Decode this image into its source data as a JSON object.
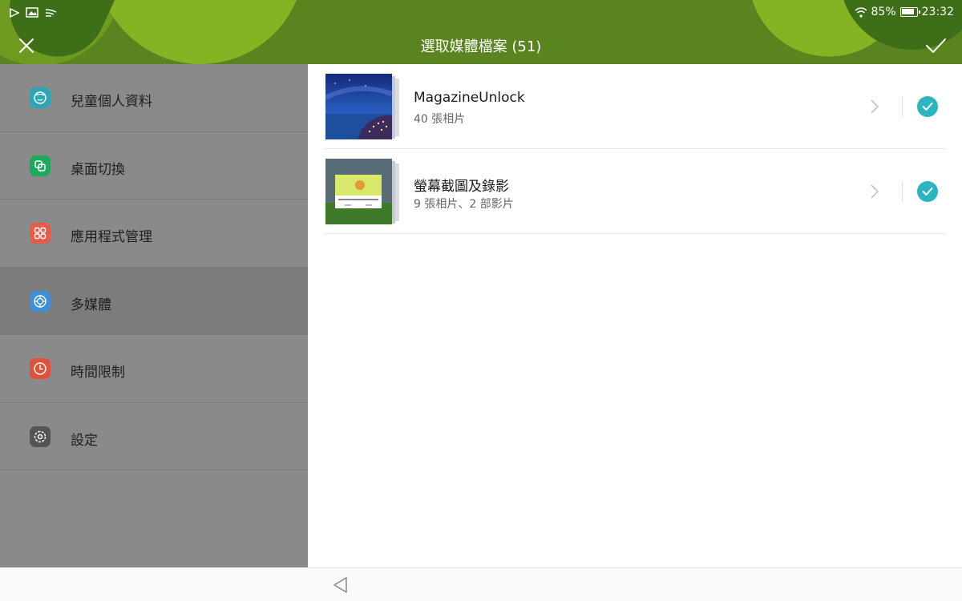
{
  "status": {
    "battery_percent": "85%",
    "time": "23:32",
    "left_icons": [
      "play-store-icon",
      "gallery-icon",
      "cast-icon"
    ]
  },
  "header": {
    "title": "選取媒體檔案 (51)",
    "color": "#5a8420"
  },
  "sidebar": {
    "items": [
      {
        "label": "兒童個人資料",
        "icon": "child-profile-icon",
        "color": "#2ba6b8"
      },
      {
        "label": "桌面切換",
        "icon": "desktop-switch-icon",
        "color": "#1eaa5c"
      },
      {
        "label": "應用程式管理",
        "icon": "app-management-icon",
        "color": "#e55c4a"
      },
      {
        "label": "多媒體",
        "icon": "multimedia-icon",
        "color": "#3d8fd6"
      },
      {
        "label": "時間限制",
        "icon": "time-limit-icon",
        "color": "#e0503a"
      },
      {
        "label": "設定",
        "icon": "settings-icon",
        "color": "#555555"
      }
    ]
  },
  "albums": [
    {
      "name": "MagazineUnlock",
      "count": "40 張相片",
      "checked": true
    },
    {
      "name": "螢幕截圖及錄影",
      "count": "9 張相片、2 部影片",
      "checked": true
    }
  ],
  "accent": "#2bb5c3"
}
